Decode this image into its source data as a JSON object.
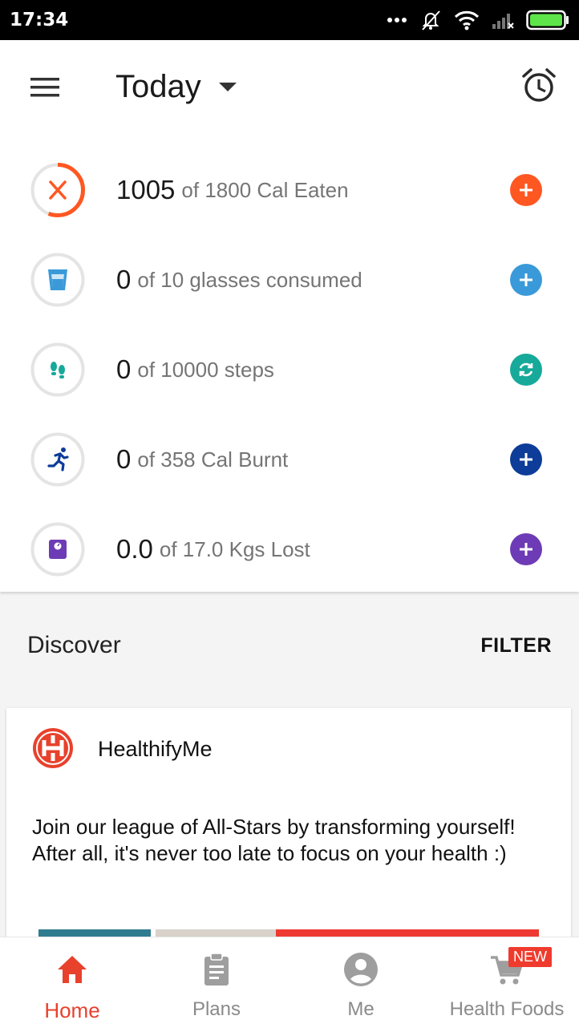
{
  "status_bar": {
    "time": "17:34",
    "icons": [
      "more-dots-icon",
      "silent-vibrate-icon",
      "wifi-icon",
      "cellular-no-signal-icon",
      "battery-full-icon"
    ]
  },
  "header": {
    "menu_icon": "hamburger-menu-icon",
    "date_label": "Today",
    "alarm_icon": "alarm-clock-icon"
  },
  "trackers": [
    {
      "id": "calories-eaten",
      "value": "1005",
      "suffix": "of 1800 Cal Eaten",
      "icon": "fork-knife-icon",
      "color": "#ff5722",
      "action_icon": "plus-icon",
      "progress": 0.558
    },
    {
      "id": "water",
      "value": "0",
      "suffix": "of 10 glasses consumed",
      "icon": "glass-icon",
      "color": "#3a9ad9",
      "action_icon": "plus-icon",
      "progress": 0
    },
    {
      "id": "steps",
      "value": "0",
      "suffix": "of 10000 steps",
      "icon": "footsteps-icon",
      "color": "#17a99a",
      "action_icon": "sync-icon",
      "progress": 0
    },
    {
      "id": "calories-burnt",
      "value": "0",
      "suffix": "of 358 Cal Burnt",
      "icon": "running-icon",
      "color": "#0d3c99",
      "action_icon": "plus-icon",
      "progress": 0
    },
    {
      "id": "weight",
      "value": "0.0",
      "suffix": "of 17.0 Kgs Lost",
      "icon": "weight-scale-icon",
      "color": "#6d3bb5",
      "action_icon": "plus-icon",
      "progress": 0
    }
  ],
  "discover": {
    "title": "Discover",
    "filter_label": "FILTER"
  },
  "feed_card": {
    "author": "HealthifyMe",
    "text": "Join our league of All-Stars by transforming yourself! After all, it's never too late to focus on your health :)"
  },
  "bottom_nav": {
    "items": [
      {
        "label": "Home",
        "icon": "home-icon",
        "active": true
      },
      {
        "label": "Plans",
        "icon": "clipboard-icon",
        "active": false
      },
      {
        "label": "Me",
        "icon": "account-circle-icon",
        "active": false
      },
      {
        "label": "Health Foods",
        "icon": "shopping-cart-icon",
        "active": false,
        "badge": "NEW"
      }
    ]
  },
  "colors": {
    "accent": "#e8412c",
    "inactive": "#8a8a8a",
    "ring": "#e4e4e4"
  }
}
